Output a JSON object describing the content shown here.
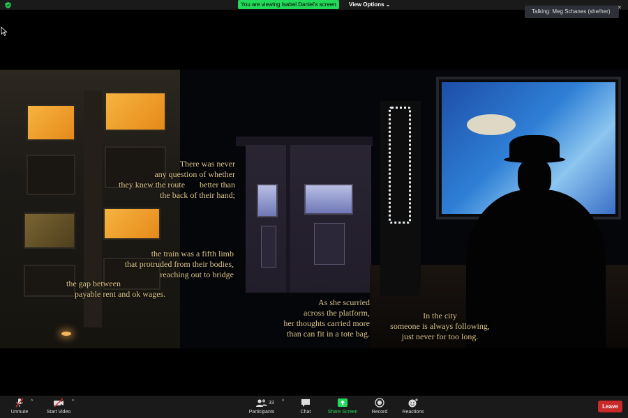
{
  "top_bar": {
    "viewing_banner": "You are viewing Isabel Daniel's screen",
    "view_options": "View Options",
    "talking_indicator": "Talking: Meg Schanes (she/her)"
  },
  "poem": {
    "stanza1": "There was never\nany question of whether\nthey knew the route       better than\nthe back of their hand;",
    "stanza2": "the train was a fifth limb\nthat protruded from their bodies,\nreaching out to bridge",
    "stanza3": "the gap between\n    payable rent and ok wages.",
    "stanza4": "As she scurried\nacross the platform,\nher thoughts carried more\nthan can fit in a tote bag.",
    "stanza5": "In the city\nsomeone is always following,\njust never for too long."
  },
  "toolbar": {
    "unmute": "Unmute",
    "start_video": "Start Video",
    "participants": "Participants",
    "participant_count": "33",
    "chat": "Chat",
    "share_screen": "Share Screen",
    "record": "Record",
    "reactions": "Reactions",
    "leave": "Leave"
  },
  "colors": {
    "banner_green": "#23d959",
    "share_green": "#23d959",
    "leave_red": "#c82a2a",
    "muted_red": "#e03030",
    "poem_text": "#d9c489"
  },
  "icons": [
    "shield-icon",
    "chevron-down-icon",
    "mouse-cursor-icon",
    "microphone-muted-icon",
    "video-off-icon",
    "participants-icon",
    "chat-icon",
    "share-screen-icon",
    "record-icon",
    "reactions-icon"
  ]
}
